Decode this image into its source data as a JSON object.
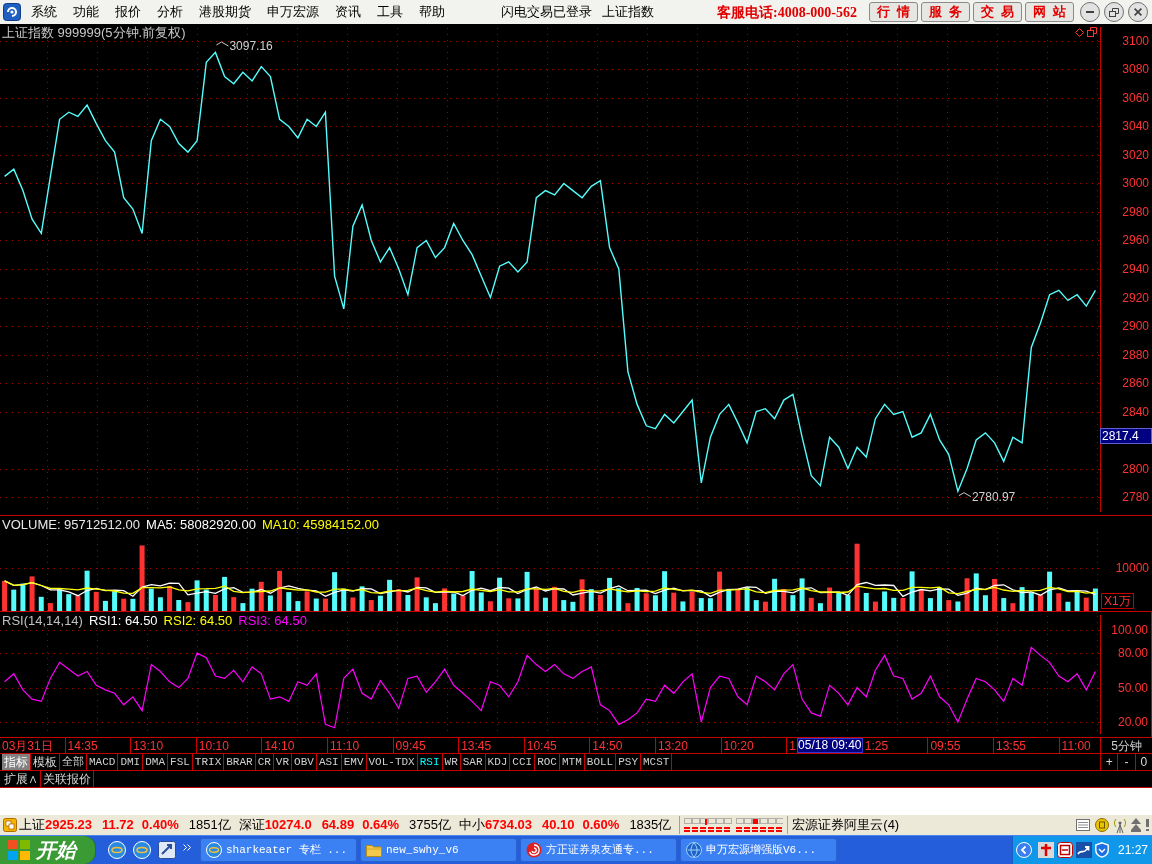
{
  "menu_bar": {
    "menus": [
      "系统",
      "功能",
      "报价",
      "分析",
      "港股期货",
      "申万宏源",
      "资讯",
      "工具",
      "帮助"
    ],
    "status_texts": [
      "闪电交易已登录",
      "上证指数"
    ],
    "hotline": "客服电话:4008-000-562",
    "buttons": [
      "行情",
      "服务",
      "交易",
      "网站"
    ]
  },
  "price_panel": {
    "cursor_price": "2817.4",
    "chart_data": {
      "type": "line",
      "title": "上证指数 999999(5分钟.前复权)",
      "grid": true,
      "ylim": [
        2767.4,
        3111.9
      ],
      "yticks": [
        3100,
        3080,
        3060,
        3040,
        3020,
        3000,
        2980,
        2960,
        2940,
        2920,
        2900,
        2880,
        2860,
        2840,
        2800,
        2780
      ],
      "series": [
        {
          "color": "#54fcfc",
          "values": [
            3005,
            3010,
            2995,
            2975,
            2965,
            3005,
            3045,
            3050,
            3047,
            3055,
            3042,
            3030,
            3022,
            2990,
            2982,
            2965,
            3030,
            3045,
            3040,
            3028,
            3022,
            3030,
            3085,
            3092,
            3075,
            3070,
            3078,
            3072,
            3082,
            3075,
            3045,
            3040,
            3032,
            3045,
            3040,
            3050,
            2935,
            2912,
            2970,
            2985,
            2960,
            2945,
            2955,
            2940,
            2922,
            2955,
            2960,
            2948,
            2955,
            2972,
            2960,
            2950,
            2935,
            2920,
            2942,
            2945,
            2938,
            2945,
            2990,
            2995,
            2992,
            3000,
            2995,
            2990,
            2998,
            3002,
            2955,
            2940,
            2868,
            2845,
            2830,
            2828,
            2838,
            2832,
            2840,
            2848,
            2790,
            2822,
            2838,
            2845,
            2832,
            2818,
            2840,
            2842,
            2835,
            2848,
            2852,
            2822,
            2795,
            2788,
            2822,
            2815,
            2800,
            2815,
            2808,
            2835,
            2845,
            2838,
            2840,
            2822,
            2825,
            2838,
            2820,
            2810,
            2784,
            2800,
            2820,
            2825,
            2818,
            2805,
            2822,
            2818,
            2885,
            2902,
            2922,
            2925,
            2918,
            2922,
            2914,
            2925
          ]
        }
      ],
      "annotations": [
        "3097.16",
        "2780.97"
      ]
    }
  },
  "volume_panel": {
    "legend": [
      {
        "text": "VOLUME: 95712512.00",
        "color": "#e8e8e8"
      },
      {
        "text": "MA5: 58082920.00",
        "color": "#ffffff"
      },
      {
        "text": "MA10: 45984152.00",
        "color": "#ffff00"
      }
    ],
    "scale_label": "10000",
    "unit": "X1万"
  },
  "rsi_panel": {
    "legend": [
      {
        "text": "RSI(14,14,14)",
        "color": "#c0c0c0"
      },
      {
        "text": "RSI1: 64.50",
        "color": "#ffffff"
      },
      {
        "text": "RSI2: 64.50",
        "color": "#ffff00"
      },
      {
        "text": "RSI3: 64.50",
        "color": "#ff00ff"
      }
    ],
    "chart_data": {
      "type": "line",
      "grid": true,
      "ylim": [
        7,
        115.7
      ],
      "yticks": [
        {
          "value": 100,
          "label": "100.00"
        },
        {
          "value": 80,
          "label": "80.00"
        },
        {
          "value": 50,
          "label": "50.00"
        },
        {
          "value": 20,
          "label": "20.00"
        }
      ],
      "series": [
        {
          "color": "#ff00ff",
          "values": [
            55,
            62,
            48,
            40,
            38,
            58,
            72,
            66,
            60,
            64,
            52,
            48,
            45,
            35,
            42,
            30,
            70,
            64,
            55,
            50,
            58,
            80,
            76,
            60,
            58,
            65,
            55,
            68,
            62,
            40,
            42,
            38,
            55,
            52,
            62,
            18,
            15,
            58,
            66,
            45,
            40,
            56,
            45,
            32,
            58,
            60,
            46,
            55,
            66,
            52,
            45,
            38,
            30,
            55,
            52,
            42,
            55,
            78,
            70,
            64,
            70,
            62,
            58,
            64,
            68,
            35,
            30,
            18,
            22,
            28,
            40,
            38,
            52,
            45,
            55,
            62,
            20,
            50,
            60,
            58,
            42,
            35,
            60,
            55,
            48,
            62,
            70,
            40,
            28,
            25,
            52,
            45,
            35,
            50,
            42,
            65,
            78,
            60,
            58,
            40,
            45,
            60,
            42,
            35,
            20,
            40,
            58,
            55,
            48,
            38,
            58,
            52,
            85,
            78,
            72,
            60,
            55,
            62,
            48,
            64
          ]
        }
      ]
    }
  },
  "time_axis": {
    "labels": [
      {
        "kind": "tick",
        "text": "03月31日"
      },
      {
        "kind": "tick",
        "text": "14:35"
      },
      {
        "kind": "tick",
        "text": "13:10"
      },
      {
        "kind": "tick",
        "text": "10:10"
      },
      {
        "kind": "tick",
        "text": "14:10"
      },
      {
        "kind": "tick",
        "text": "11:10"
      },
      {
        "kind": "tick",
        "text": "09:45"
      },
      {
        "kind": "tick",
        "text": "13:45"
      },
      {
        "kind": "tick",
        "text": "10:45"
      },
      {
        "kind": "tick",
        "text": "14:50"
      },
      {
        "kind": "tick",
        "text": "13:20"
      },
      {
        "kind": "tick",
        "text": "10:20"
      },
      {
        "kind": "partial",
        "text": "1"
      },
      {
        "kind": "cursor",
        "text": "05/18 09:40"
      },
      {
        "kind": "tick",
        "text": "1:25"
      },
      {
        "kind": "tick",
        "text": "09:55"
      },
      {
        "kind": "tick",
        "text": "13:55"
      },
      {
        "kind": "tick",
        "text": "11:00"
      }
    ],
    "period": "5分钟"
  },
  "mode_tabs": [
    {
      "label": "指标",
      "selected": true
    },
    {
      "label": "模板",
      "selected": false
    }
  ],
  "indicator_tabs": [
    {
      "label": "全部",
      "selected": false
    },
    {
      "label": "MACD",
      "selected": false
    },
    {
      "label": "DMI",
      "selected": false
    },
    {
      "label": "DMA",
      "selected": false
    },
    {
      "label": "FSL",
      "selected": false
    },
    {
      "label": "TRIX",
      "selected": false
    },
    {
      "label": "BRAR",
      "selected": false
    },
    {
      "label": "CR",
      "selected": false
    },
    {
      "label": "VR",
      "selected": false
    },
    {
      "label": "OBV",
      "selected": false
    },
    {
      "label": "ASI",
      "selected": false
    },
    {
      "label": "EMV",
      "selected": false
    },
    {
      "label": "VOL-TDX",
      "selected": false
    },
    {
      "label": "RSI",
      "selected": true
    },
    {
      "label": "WR",
      "selected": false
    },
    {
      "label": "SAR",
      "selected": false
    },
    {
      "label": "KDJ",
      "selected": false
    },
    {
      "label": "CCI",
      "selected": false
    },
    {
      "label": "ROC",
      "selected": false
    },
    {
      "label": "MTM",
      "selected": false
    },
    {
      "label": "BOLL",
      "selected": false
    },
    {
      "label": "PSY",
      "selected": false
    },
    {
      "label": "MCST",
      "selected": false
    }
  ],
  "zoom_buttons": [
    "+",
    "-",
    "0"
  ],
  "extra_tabs": [
    "扩展∧",
    "关联报价"
  ],
  "status_bar": {
    "indices": [
      {
        "name": "上证",
        "value": "2925.23",
        "change": "11.72",
        "percent": "0.40%",
        "amount": "1851亿"
      },
      {
        "name": "深证",
        "value": "10274.0",
        "change": "64.89",
        "percent": "0.64%",
        "amount": "3755亿"
      },
      {
        "name": "中小",
        "value": "6734.03",
        "change": "40.10",
        "percent": "0.60%",
        "amount": "1835亿"
      }
    ],
    "server": "宏源证券阿里云(4)"
  },
  "taskbar": {
    "start": "开始",
    "tasks": [
      {
        "kind": "browser",
        "label": "sharkeater 专栏 ..."
      },
      {
        "kind": "folder",
        "label": "new_swhy_v6"
      },
      {
        "kind": "swirl",
        "label": "方正证券泉友通专..."
      },
      {
        "kind": "globe",
        "label": "申万宏源增强版V6..."
      }
    ],
    "clock": "21:27"
  }
}
